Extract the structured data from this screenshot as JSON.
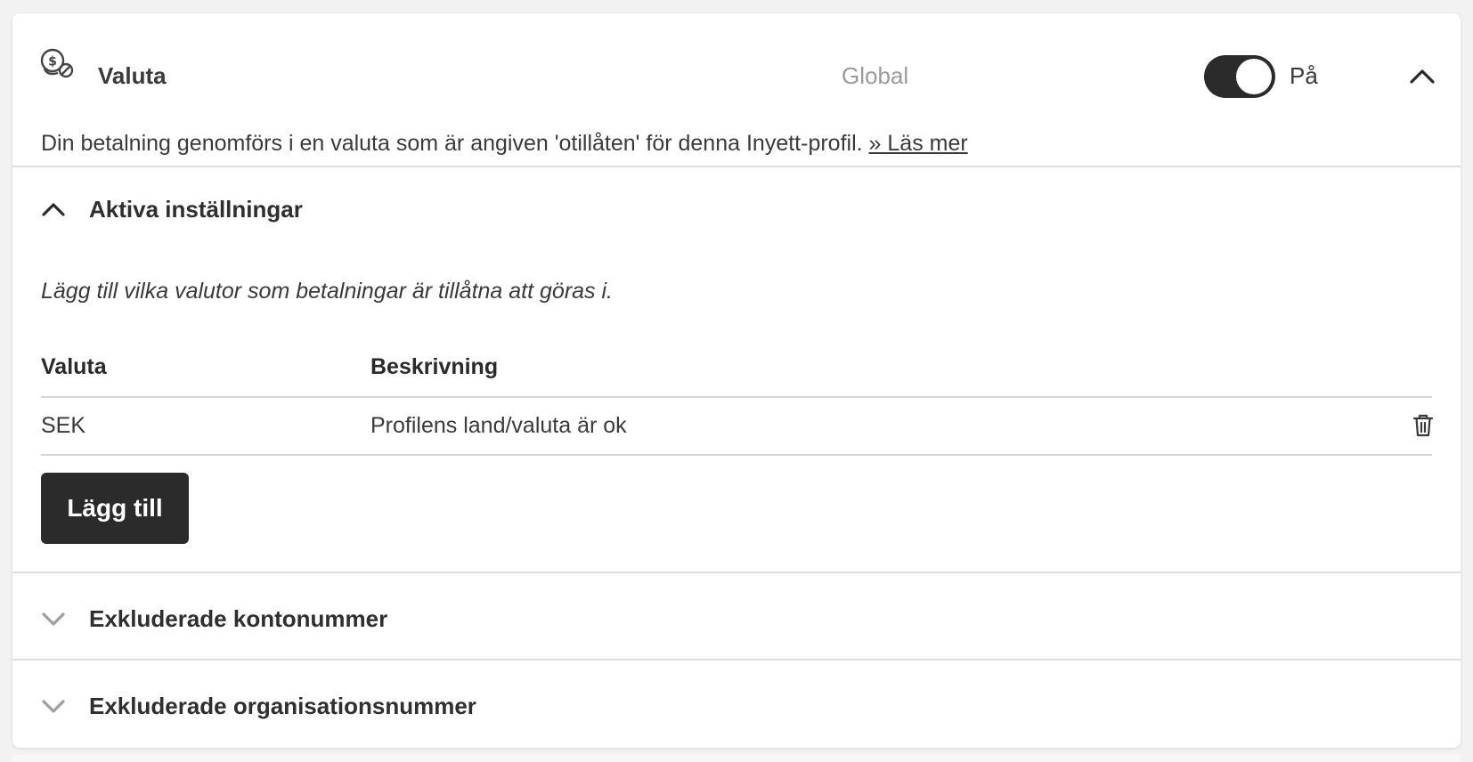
{
  "header": {
    "icon": "coin-currency-icon",
    "title": "Valuta",
    "scope": "Global",
    "toggle": {
      "on": true,
      "label": "På"
    },
    "collapse_icon": "chevron-up-icon"
  },
  "description": {
    "text": "Din betalning genomförs i en valuta som är angiven 'otillåten' för denna Inyett-profil.",
    "link_label": "» Läs mer"
  },
  "active_settings": {
    "title": "Aktiva inställningar",
    "expanded": true,
    "hint": "Lägg till vilka valutor som betalningar är tillåtna att göras i.",
    "columns": [
      "Valuta",
      "Beskrivning"
    ],
    "rows": [
      {
        "currency": "SEK",
        "description": "Profilens land/valuta är ok"
      }
    ],
    "add_button_label": "Lägg till"
  },
  "excluded_accounts": {
    "title": "Exkluderade kontonummer",
    "expanded": false
  },
  "excluded_orgs": {
    "title": "Exkluderade organisationsnummer",
    "expanded": false
  },
  "colors": {
    "accent_dark": "#2b2b2b",
    "muted_text": "#9a9a9a",
    "chevron_collapsed": "#9e9e9e",
    "background": "#f2f2f2"
  }
}
